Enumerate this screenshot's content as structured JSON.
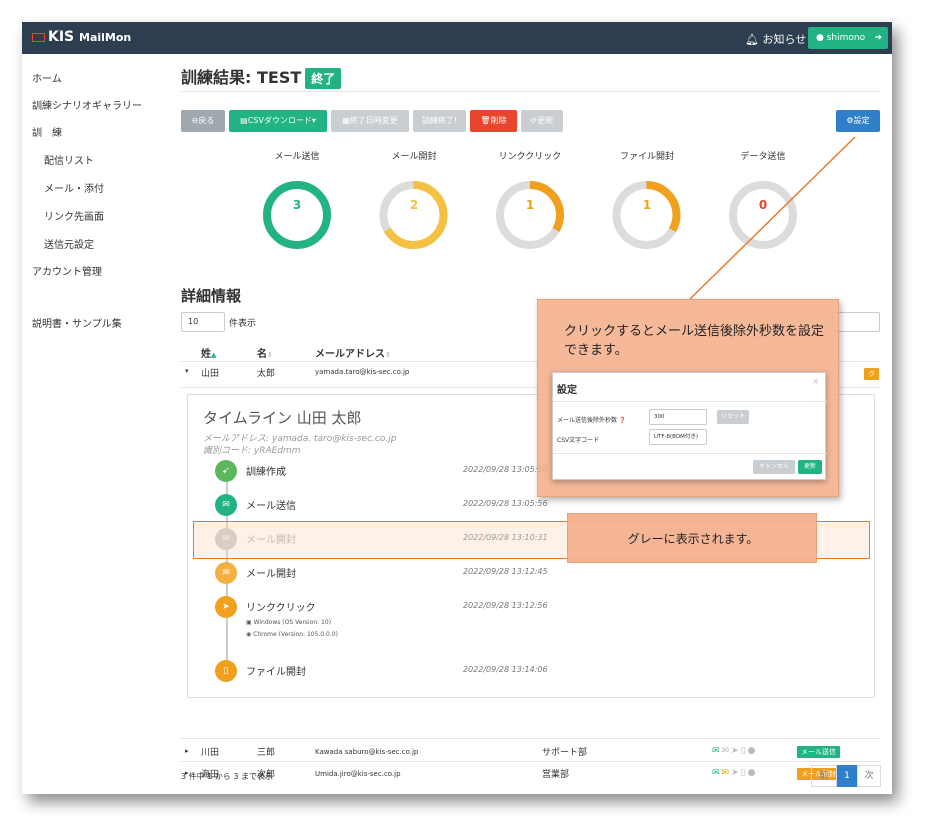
{
  "app": {
    "logo": "KIS",
    "logo_sub": "MailMon",
    "notice": "お知らせ",
    "user": "shimono"
  },
  "sidebar": {
    "items": [
      {
        "label": "ホーム"
      },
      {
        "label": "訓練シナリオギャラリー"
      },
      {
        "label": "訓　練"
      },
      {
        "label": "配信リスト"
      },
      {
        "label": "メール・添付"
      },
      {
        "label": "リンク先画面"
      },
      {
        "label": "送信元設定"
      },
      {
        "label": "アカウント管理"
      },
      {
        "label": "説明書・サンプル集"
      }
    ]
  },
  "page": {
    "title": "訓練結果: TEST",
    "status": "終了"
  },
  "toolbar": {
    "back": "戻る",
    "csv": "CSVダウンロード▾",
    "change_date": "終了日時変更",
    "end": "訓練終了!",
    "delete": "削除",
    "refresh": "更新",
    "settings": "設定"
  },
  "gauges": [
    {
      "label": "メール送信",
      "value": "3",
      "fraction": 1.0,
      "color": "#21b384"
    },
    {
      "label": "メール開封",
      "value": "2",
      "fraction": 0.667,
      "color": "#f4c142"
    },
    {
      "label": "リンククリック",
      "value": "1",
      "fraction": 0.333,
      "color": "#f0a01c"
    },
    {
      "label": "ファイル開封",
      "value": "1",
      "fraction": 0.333,
      "color": "#f0a01c"
    },
    {
      "label": "データ送信",
      "value": "0",
      "fraction": 0.0,
      "color": "#e8452c"
    }
  ],
  "details": {
    "title": "詳細情報",
    "per_page": "10",
    "per_page_label": "件表示",
    "columns": {
      "last": "姓",
      "first": "名",
      "email": "メールアドレス"
    }
  },
  "rows": [
    {
      "toggle": "▾",
      "last": "山田",
      "first": "太郎",
      "email": "yamada.taro@kis-sec.co.jp",
      "dept": "",
      "tag": "ク"
    },
    {
      "toggle": "▸",
      "last": "川田",
      "first": "三郎",
      "email": "Kawada saburo@kis-sec.co.jp",
      "dept": "サポート部",
      "tag": "メール送信"
    },
    {
      "toggle": "▸",
      "last": "海田",
      "first": "次郎",
      "email": "Umida.jiro@kis-sec.co.jp",
      "dept": "営業部",
      "tag": "メール開封"
    }
  ],
  "timeline": {
    "title": "タイムライン 山田 太郎",
    "email_label": "メールアドレス: yamada. taro@kis-sec.co.jp",
    "code_label": "識別コード: yRAEdmm",
    "events": [
      {
        "label": "訓練作成",
        "date": "2022/09/28 13:05:56",
        "icon": "rocket-icon",
        "glyph": "➹",
        "color": "#5cb85c"
      },
      {
        "label": "メール送信",
        "date": "2022/09/28 13:05:56",
        "icon": "envelope-icon",
        "glyph": "✉",
        "color": "#21b384"
      },
      {
        "label": "メール開封",
        "date": "2022/09/28 13:10:31",
        "icon": "envelope-open-icon",
        "glyph": "✉",
        "color": "#c8c8c8"
      },
      {
        "label": "メール開封",
        "date": "2022/09/28 13:12:45",
        "icon": "envelope-open-icon",
        "glyph": "✉",
        "color": "#f4b040"
      },
      {
        "label": "リンククリック",
        "date": "2022/09/28 13:12:56",
        "icon": "pointer-icon",
        "glyph": "➤",
        "color": "#f0a01c"
      },
      {
        "label": "ファイル開封",
        "date": "2022/09/28 13:14:06",
        "icon": "file-icon",
        "glyph": "▯",
        "color": "#f0a01c"
      }
    ],
    "os": "Windows (OS Version: 10)",
    "browser": "Chrome (Version: 105.0.0.0)"
  },
  "footer": {
    "count": "3 件中 1 から 3 まで表示",
    "prev": "前",
    "page": "1",
    "next": "次"
  },
  "callout_settings": {
    "text": "クリックするとメール送信後除外秒数を設定できます。",
    "dialog_title": "設定",
    "close": "×",
    "field1_label": "メール送信後除外秒数 ❓",
    "field1_value": "300",
    "reset": "リセット",
    "field2_label": "CSV文字コード",
    "field2_value": "UTF-8(BOM付き)",
    "cancel": "キャンセル",
    "update": "更新"
  },
  "callout_gray": {
    "text": "グレーに表示されます。"
  }
}
